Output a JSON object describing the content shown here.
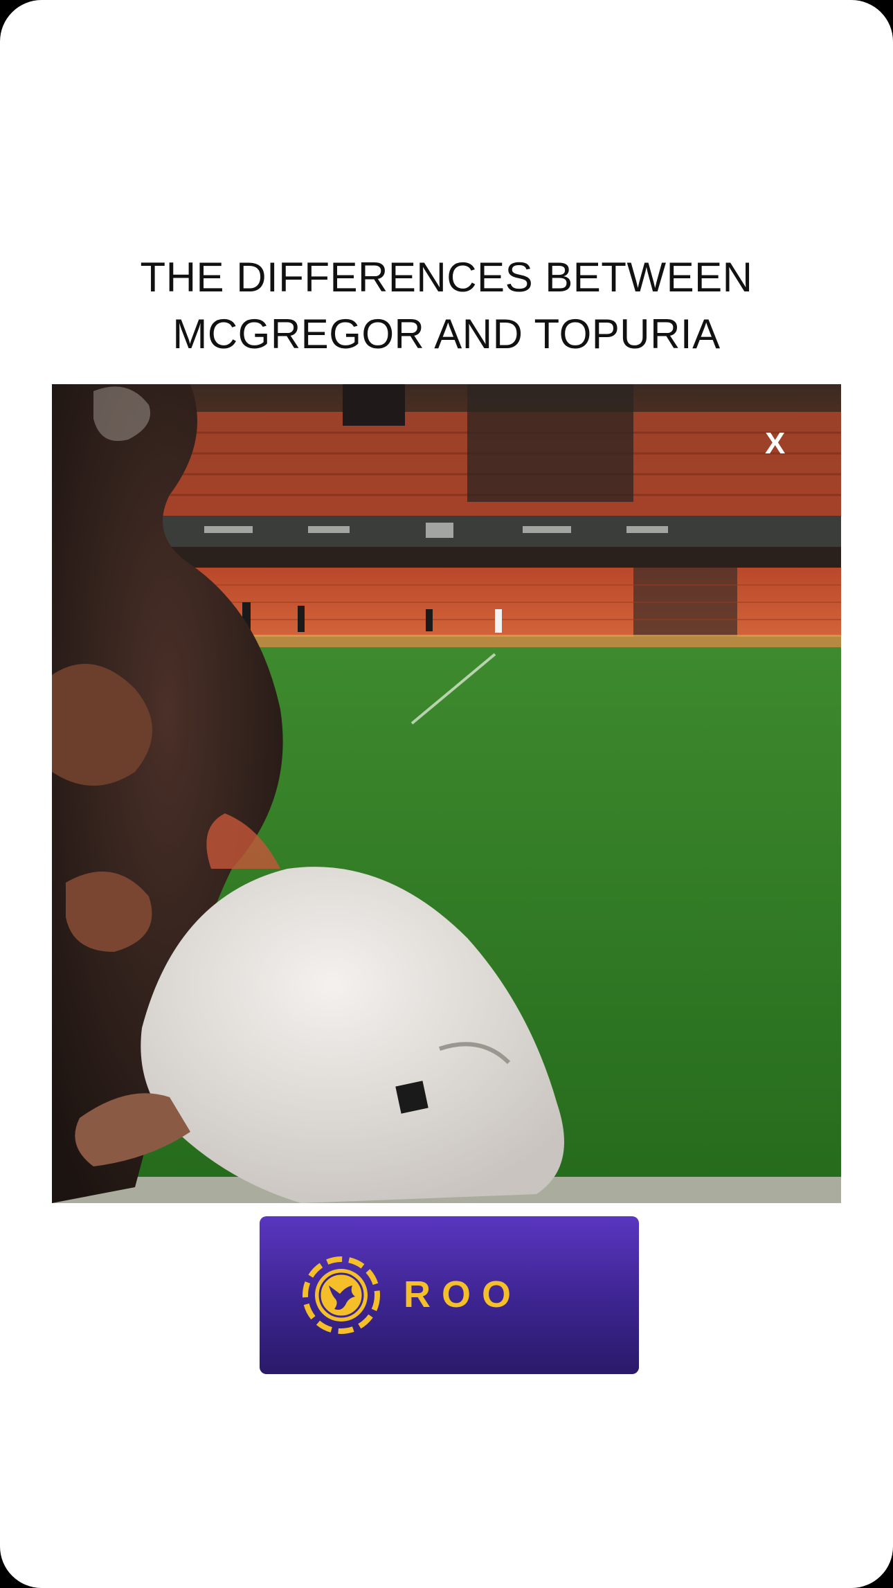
{
  "post": {
    "headline_line1": "THE DIFFERENCES BETWEEN",
    "headline_line2": "MCGREGOR AND TOPURIA"
  },
  "video": {
    "stadium_mark": "X"
  },
  "promo": {
    "brand": "ROO",
    "logo_icon": "kangaroo-chip-icon"
  },
  "colors": {
    "background": "#ffffff",
    "headline_text": "#111111",
    "promo_bg_top": "#5a36c0",
    "promo_bg_bottom": "#2a1a6a",
    "promo_accent": "#f5bf2a",
    "pitch_green": "#2f7a26",
    "stand_seats": "#c8502c"
  }
}
